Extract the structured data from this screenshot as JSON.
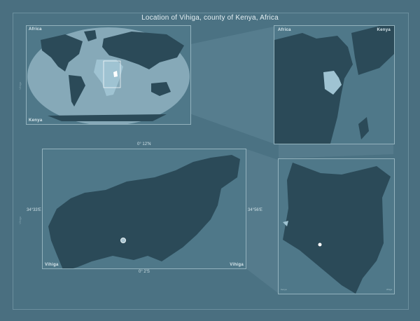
{
  "title": "Location of Vihiga, county of Kenya, Africa",
  "world_panel": {
    "label_top": "Africa",
    "label_bottom": "Kenya"
  },
  "africa_panel": {
    "label_left": "Africa",
    "label_right": "Kenya"
  },
  "county_panel": {
    "lat_top": "0° 12'N",
    "lat_bottom": "0° 2'S",
    "lon_left": "34°33'E",
    "lon_right": "34°56'E",
    "name_left": "Vihiga",
    "name_right": "Vihiga"
  },
  "kenya_panel": {
    "label_left": "Kenya",
    "label_right": "Vihiga"
  },
  "side_text": {
    "top": "Vihiga",
    "bottom": "Vihiga"
  },
  "colors": {
    "background": "#4a6f80",
    "land": "#2b4a58",
    "highlight": "#9fc3d2",
    "accent_white": "#ffffff"
  }
}
